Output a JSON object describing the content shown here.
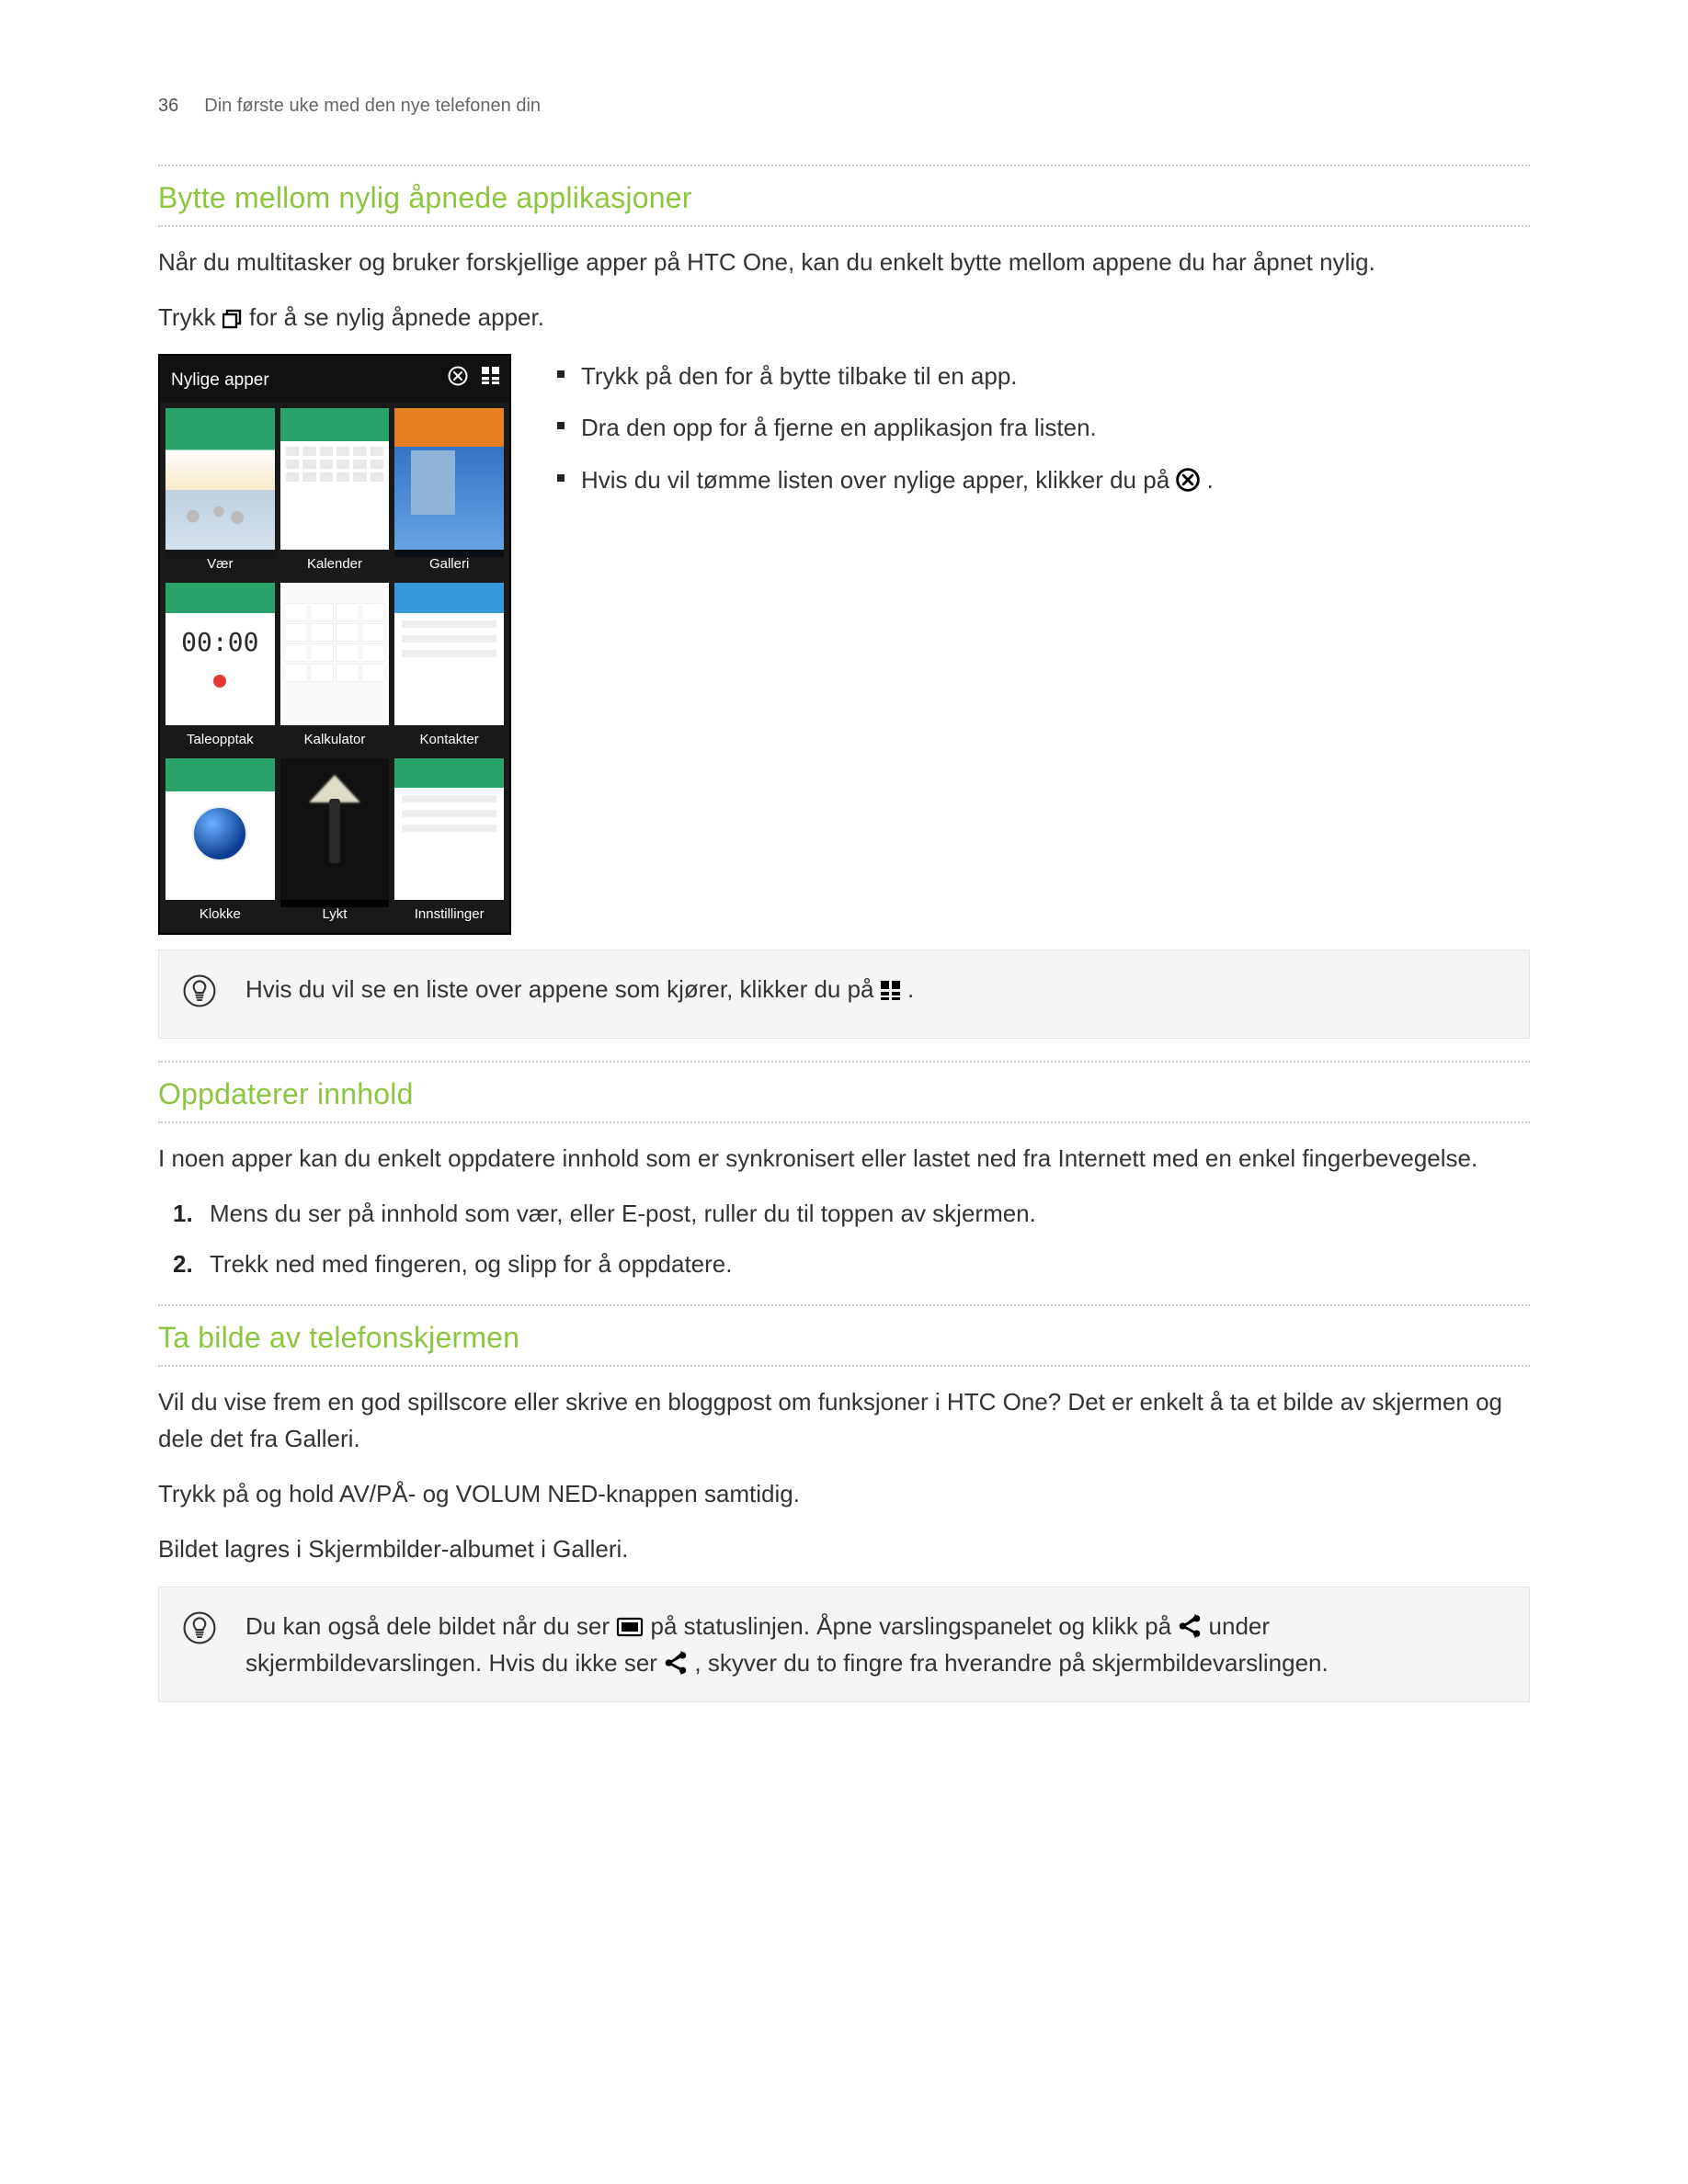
{
  "header": {
    "page_number": "36",
    "running_title": "Din første uke med den nye telefonen din"
  },
  "sections": {
    "recent": {
      "title": "Bytte mellom nylig åpnede applikasjoner",
      "intro": "Når du multitasker og bruker forskjellige apper på HTC One, kan du enkelt bytte mellom appene du har åpnet nylig.",
      "press_before": "Trykk ",
      "press_after": " for å se nylig åpnede apper.",
      "bullets": {
        "b1": "Trykk på den for å bytte tilbake til en app.",
        "b2": "Dra den opp for å fjerne en applikasjon fra listen.",
        "b3_before": "Hvis du vil tømme listen over nylige apper, klikker du på ",
        "b3_after": "."
      },
      "phone": {
        "bar_title": "Nylige apper",
        "tiles": [
          "Vær",
          "Kalender",
          "Galleri",
          "Taleopptak",
          "Kalkulator",
          "Kontakter",
          "Klokke",
          "Lykt",
          "Innstillinger"
        ],
        "taleopptak_digits": "00:00"
      },
      "tip_before": "Hvis du vil se en liste over appene som kjører, klikker du på ",
      "tip_after": "."
    },
    "update": {
      "title": "Oppdaterer innhold",
      "intro": "I noen apper kan du enkelt oppdatere innhold som er synkronisert eller lastet ned fra Internett med en enkel fingerbevegelse.",
      "steps": {
        "s1": "Mens du ser på innhold som vær, eller E-post, ruller du til toppen av skjermen.",
        "s2": "Trekk ned med fingeren, og slipp for å oppdatere."
      }
    },
    "screenshot": {
      "title": "Ta bilde av telefonskjermen",
      "p1": "Vil du vise frem en god spillscore eller skrive en bloggpost om funksjoner i HTC One? Det er enkelt å ta et bilde av skjermen og dele det fra Galleri.",
      "p2": "Trykk på og hold AV/PÅ- og VOLUM NED-knappen samtidig.",
      "p3": "Bildet lagres i Skjermbilder-albumet i Galleri.",
      "tip_a": "Du kan også dele bildet når du ser ",
      "tip_b": " på statuslinjen. Åpne varslingspanelet og klikk på ",
      "tip_c": " under skjermbildevarslingen. Hvis du ikke ser ",
      "tip_d": ", skyver du to fingre fra hverandre på skjermbildevarslingen."
    }
  },
  "colors": {
    "accent": "#8cc63f"
  }
}
